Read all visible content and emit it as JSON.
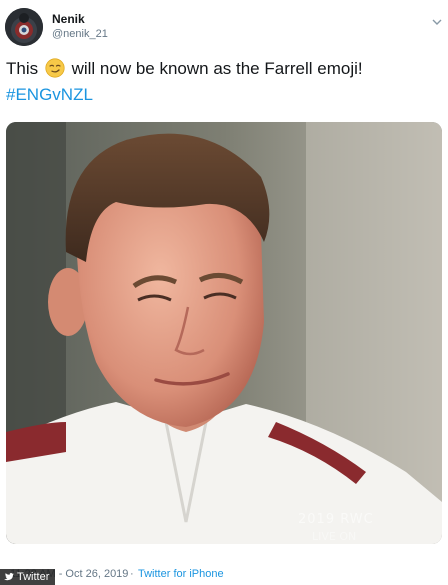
{
  "user": {
    "name": "Nenik",
    "handle": "@nenik_21"
  },
  "tweet": {
    "text_before": "This",
    "emoji": "smirking-face",
    "text_after": "will now be known as the Farrell emoji!",
    "hashtag": "#ENGvNZL"
  },
  "media": {
    "watermark_line1": "2019 RWC",
    "watermark_line2": "LIVE ON"
  },
  "footer": {
    "timestamp": "11:28 AM - Oct 26, 2019",
    "separator": "·",
    "source": "Twitter for iPhone"
  },
  "credit": {
    "label": "Twitter"
  },
  "colors": {
    "link": "#1b95e0",
    "muted": "#657786",
    "text": "#14171a"
  },
  "icons": [
    "avatar-image",
    "chevron-down-icon",
    "smirk-emoji-icon",
    "twitter-bird-icon"
  ]
}
